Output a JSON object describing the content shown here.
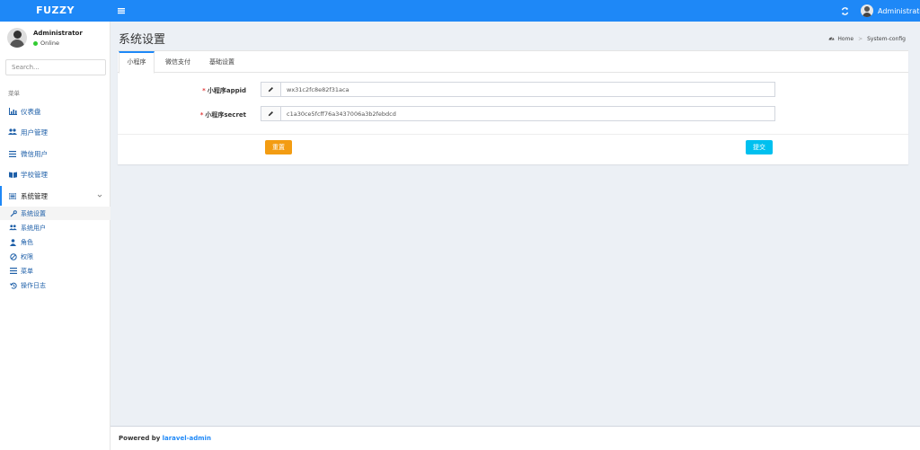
{
  "header": {
    "logo": "FUZZY",
    "user_name": "Administrator"
  },
  "sidebar": {
    "user_name": "Administrator",
    "user_status": "Online",
    "search_placeholder": "Search...",
    "menu_header": "菜单",
    "items": [
      {
        "label": "仪表盘",
        "icon": "bar-chart-icon"
      },
      {
        "label": "用户管理",
        "icon": "users-icon"
      },
      {
        "label": "微信用户",
        "icon": "list-icon"
      },
      {
        "label": "学校管理",
        "icon": "book-icon"
      },
      {
        "label": "系统管理",
        "icon": "tasks-icon"
      }
    ],
    "submenu": [
      {
        "label": "系统设置",
        "icon": "wrench-icon"
      },
      {
        "label": "系统用户",
        "icon": "users-icon"
      },
      {
        "label": "角色",
        "icon": "user-icon"
      },
      {
        "label": "权限",
        "icon": "ban-icon"
      },
      {
        "label": "菜单",
        "icon": "bars-icon"
      },
      {
        "label": "操作日志",
        "icon": "history-icon"
      }
    ]
  },
  "content": {
    "title": "系统设置",
    "breadcrumb": {
      "home": "Home",
      "current": "System-config"
    }
  },
  "tabs": [
    "小程序",
    "微信支付",
    "基础设置"
  ],
  "form": {
    "fields": [
      {
        "label": "小程序appid",
        "value": "wx31c2fc8e82f31aca"
      },
      {
        "label": "小程序secret",
        "value": "c1a30ce5fcff76a3437006a3b2febdcd"
      }
    ],
    "reset_label": "重置",
    "submit_label": "提交"
  },
  "footer": {
    "powered_by": "Powered by",
    "link_text": "laravel-admin"
  },
  "colors": {
    "brand": "#1e88f7",
    "reset_button": "#f39c12",
    "submit_button": "#00c0ef"
  }
}
